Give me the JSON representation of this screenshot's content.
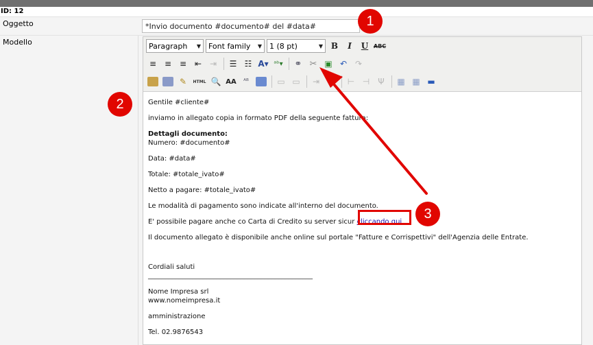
{
  "header": {
    "id_label": "ID: 12"
  },
  "fields": {
    "oggetto_label": "Oggetto",
    "oggetto_value": "*Invio documento #documento# del #data#",
    "modello_label": "Modello"
  },
  "toolbar": {
    "paragraph": "Paragraph",
    "font_family": "Font family",
    "font_size": "1 (8 pt)",
    "bold": "B",
    "italic": "I",
    "underline": "U",
    "strike": "ABC",
    "html": "HTML"
  },
  "body": {
    "greeting": "Gentile #cliente#",
    "intro": "inviamo in allegato copia in formato PDF della seguente fattura:",
    "details_title": "Dettagli documento:",
    "numero": "Numero: #documento#",
    "data": "Data: #data#",
    "totale": "Totale: #totale_ivato#",
    "netto": "Netto a pagare: #totale_ivato#",
    "modalita": "Le modalità di pagamento sono indicate all'interno del documento.",
    "pay_prefix": "E' possibile pagare anche co  Carta di Credito su server sicur",
    "pay_link": "cliccando qui",
    "online": "Il documento allegato è disponibile anche online sul portale \"Fatture e Corrispettivi\" dell'Agenzia delle Entrate.",
    "saluti": "Cordiali saluti",
    "rule": "________________________________________________",
    "company": "Nome Impresa srl",
    "website": "www.nomeimpresa.it",
    "dept": "amministrazione",
    "tel": "Tel. 02.9876543"
  },
  "annotations": {
    "one": "1",
    "two": "2",
    "three": "3"
  },
  "colors": {
    "annotation_red": "#e10600",
    "link": "#1a0dab"
  }
}
